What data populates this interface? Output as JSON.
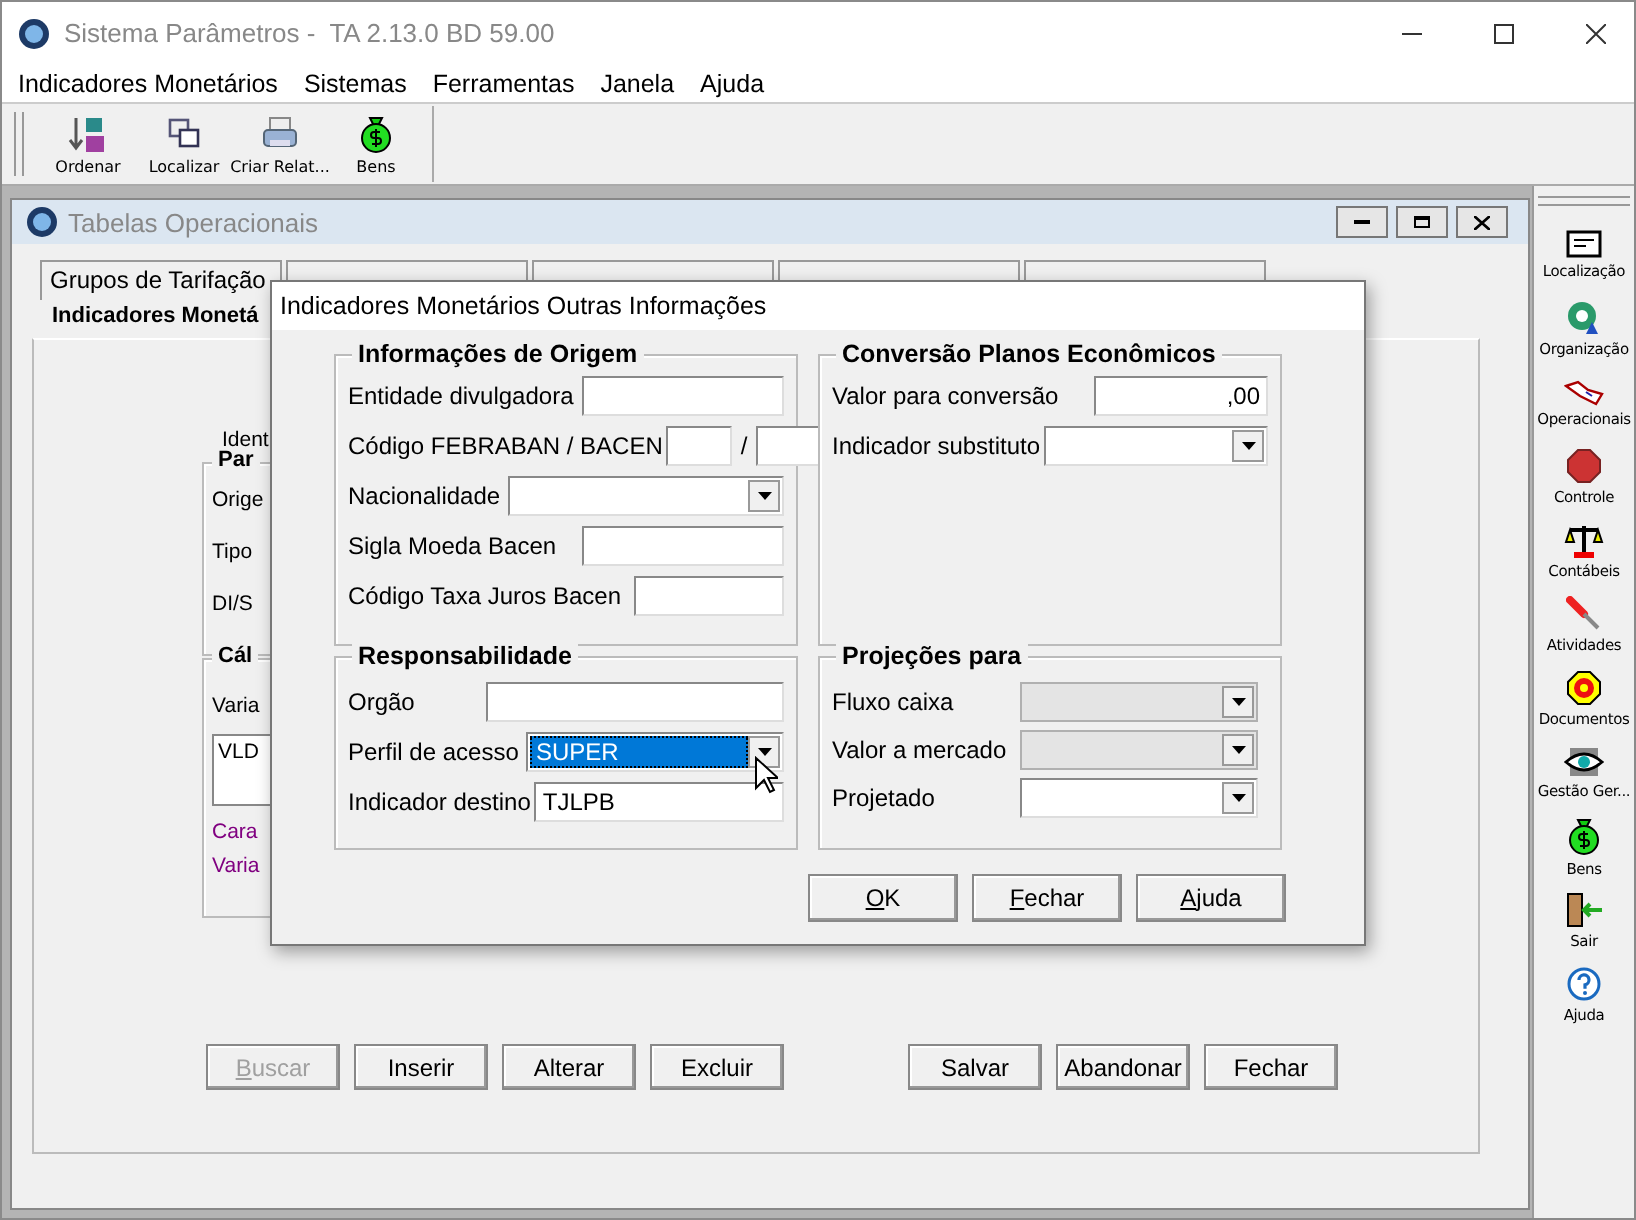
{
  "window": {
    "title": "Sistema Parâmetros -  TA 2.13.0 BD 59.00"
  },
  "menu": [
    "Indicadores Monetários",
    "Sistemas",
    "Ferramentas",
    "Janela",
    "Ajuda"
  ],
  "toolbar": [
    {
      "label": "Ordenar",
      "kind": "sort"
    },
    {
      "label": "Localizar",
      "kind": "find"
    },
    {
      "label": "Criar Relat...",
      "kind": "print"
    },
    {
      "label": "Bens",
      "kind": "money"
    }
  ],
  "sidebar": [
    {
      "label": "Localização",
      "kind": "card"
    },
    {
      "label": "Organização",
      "kind": "org"
    },
    {
      "label": "Operacionais",
      "kind": "hand"
    },
    {
      "label": "Controle",
      "kind": "stop"
    },
    {
      "label": "Contábeis",
      "kind": "scale"
    },
    {
      "label": "Atividades",
      "kind": "tool"
    },
    {
      "label": "Documentos",
      "kind": "target"
    },
    {
      "label": "Gestão Ger...",
      "kind": "eye"
    },
    {
      "label": "Bens",
      "kind": "money"
    },
    {
      "label": "Sair",
      "kind": "door"
    },
    {
      "label": "Ajuda",
      "kind": "help"
    }
  ],
  "inner_window": {
    "title": "Tabelas Operacionais",
    "tabs": [
      {
        "label": "Grupos de Tarifação",
        "selected": false
      },
      {
        "selected": false
      },
      {
        "selected": false
      },
      {
        "selected": false
      },
      {
        "selected": false
      }
    ],
    "active_tab": {
      "label": "Indicadores Monetá",
      "selected": true
    },
    "identification_label": "Ident",
    "group_1": {
      "title": "Par",
      "labels": [
        "Orige",
        "Tipo",
        "DI/S"
      ]
    },
    "group_2": {
      "title": "Cál",
      "label": "Varia",
      "list_items": [
        "VLD"
      ],
      "links": [
        "Cara",
        "Varia"
      ]
    },
    "buttons": [
      {
        "accel": "B",
        "rest": "uscar",
        "disabled": true
      },
      {
        "rest": "Inserir",
        "disabled": false
      },
      {
        "rest": "Alterar",
        "disabled": false
      },
      {
        "rest": "Excluir",
        "disabled": false
      },
      {
        "rest": "Salvar",
        "disabled": false
      },
      {
        "rest": "Abandonar",
        "disabled": false
      },
      {
        "rest": "Fechar",
        "disabled": false
      }
    ]
  },
  "dialog": {
    "title": "Indicadores Monetários Outras Informações",
    "groups": [
      {
        "title": "Informações de Origem",
        "fields": [
          {
            "label": "Entidade divulgadora",
            "kind": "text"
          },
          {
            "label": "Código FEBRABAN / BACEN",
            "kind": "pair",
            "separator": "/"
          },
          {
            "label": "Nacionalidade",
            "kind": "dropdown",
            "disabled": false
          },
          {
            "label": "Sigla Moeda Bacen",
            "kind": "text"
          },
          {
            "label": "Código Taxa Juros Bacen",
            "kind": "short"
          }
        ]
      },
      {
        "title": "Conversão Planos Econômicos",
        "fields": [
          {
            "label": "Valor para conversão",
            "kind": "number",
            "value": ",00"
          },
          {
            "label": "Indicador substituto",
            "kind": "dropdown",
            "disabled": false
          }
        ]
      },
      {
        "title": "Responsabilidade",
        "fields": [
          {
            "label": "Orgão",
            "kind": "text"
          },
          {
            "label": "Perfil de acesso",
            "kind": "dropdown",
            "value": "SUPER",
            "disabled": false,
            "selected": true
          },
          {
            "label": "Indicador destino",
            "kind": "text",
            "value": "TJLPB"
          }
        ]
      },
      {
        "title": "Projeções para",
        "fields": [
          {
            "label": "Fluxo caixa",
            "kind": "dropdown",
            "disabled": true
          },
          {
            "label": "Valor a mercado",
            "kind": "dropdown",
            "disabled": true
          },
          {
            "label": "Projetado",
            "kind": "dropdown",
            "disabled": false
          }
        ]
      }
    ],
    "buttons": [
      {
        "accel": "O",
        "rest": "K"
      },
      {
        "accel": "F",
        "rest": "echar"
      },
      {
        "accel": "A",
        "rest": "juda"
      }
    ]
  }
}
